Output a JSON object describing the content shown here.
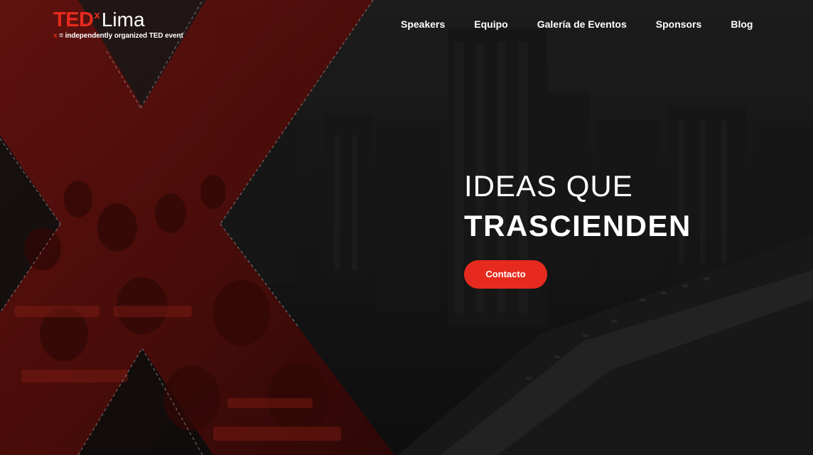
{
  "brand": {
    "ted": "TED",
    "x": "x",
    "city": "Lima",
    "tagline_x": "x",
    "tagline_rest": " = independently organized TED event",
    "accent_color": "#e62b1e"
  },
  "nav": {
    "items": [
      {
        "label": "Speakers"
      },
      {
        "label": "Equipo"
      },
      {
        "label": "Galería de Eventos"
      },
      {
        "label": "Sponsors"
      },
      {
        "label": "Blog"
      }
    ]
  },
  "hero": {
    "headline_line1": "IDEAS QUE",
    "headline_line2": "TRASCIENDEN",
    "cta_label": "Contacto",
    "background_image": "city-skyline-and-audience-photo-with-red-x-overlay"
  }
}
